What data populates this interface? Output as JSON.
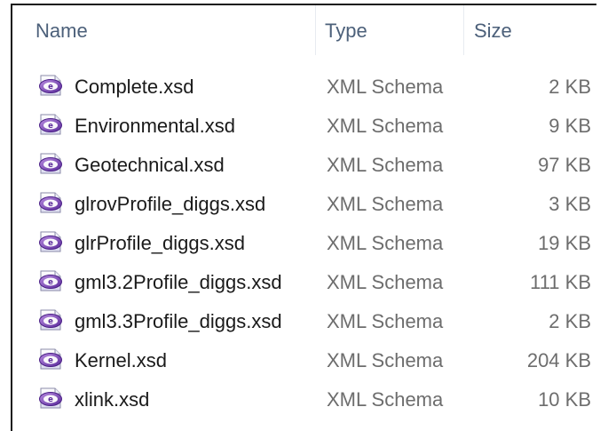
{
  "columns": {
    "name": "Name",
    "type": "Type",
    "size": "Size"
  },
  "files": [
    {
      "name": "Complete.xsd",
      "type": "XML Schema",
      "size": "2 KB",
      "icon": "xml-schema-icon"
    },
    {
      "name": "Environmental.xsd",
      "type": "XML Schema",
      "size": "9 KB",
      "icon": "xml-schema-icon"
    },
    {
      "name": "Geotechnical.xsd",
      "type": "XML Schema",
      "size": "97 KB",
      "icon": "xml-schema-icon"
    },
    {
      "name": "glrovProfile_diggs.xsd",
      "type": "XML Schema",
      "size": "3 KB",
      "icon": "xml-schema-icon"
    },
    {
      "name": "glrProfile_diggs.xsd",
      "type": "XML Schema",
      "size": "19 KB",
      "icon": "xml-schema-icon"
    },
    {
      "name": "gml3.2Profile_diggs.xsd",
      "type": "XML Schema",
      "size": "111 KB",
      "icon": "xml-schema-icon"
    },
    {
      "name": "gml3.3Profile_diggs.xsd",
      "type": "XML Schema",
      "size": "2 KB",
      "icon": "xml-schema-icon"
    },
    {
      "name": "Kernel.xsd",
      "type": "XML Schema",
      "size": "204 KB",
      "icon": "xml-schema-icon"
    },
    {
      "name": "xlink.xsd",
      "type": "XML Schema",
      "size": "10 KB",
      "icon": "xml-schema-icon"
    }
  ],
  "colors": {
    "header_text": "#4c607a",
    "name_text": "#1a1a1a",
    "meta_text": "#6d6d6d",
    "icon_accent": "#7b3fb8"
  }
}
